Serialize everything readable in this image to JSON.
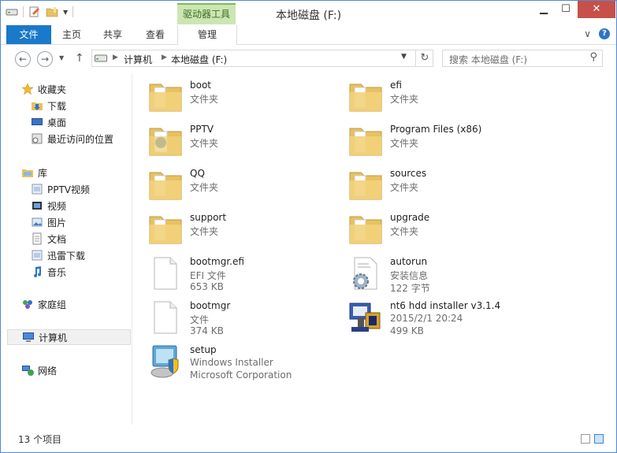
{
  "window": {
    "title": "本地磁盘 (F:)",
    "context_tab": "驱动器工具"
  },
  "ribbon": {
    "tabs": [
      "文件",
      "主页",
      "共享",
      "查看",
      "管理"
    ]
  },
  "address": {
    "crumbs": [
      "计算机",
      "本地磁盘 (F:)"
    ]
  },
  "search": {
    "placeholder": "搜索 本地磁盘 (F:)"
  },
  "nav": {
    "favorites": "收藏夹",
    "fav_items": [
      "下载",
      "桌面",
      "最近访问的位置"
    ],
    "libraries": "库",
    "lib_items": [
      "PPTV视频",
      "视频",
      "图片",
      "文档",
      "迅雷下载",
      "音乐"
    ],
    "homegroup": "家庭组",
    "computer": "计算机",
    "network": "网络"
  },
  "files": [
    {
      "name": "boot",
      "sub1": "文件夹",
      "icon": "folder-icon"
    },
    {
      "name": "efi",
      "sub1": "文件夹",
      "icon": "folder-icon"
    },
    {
      "name": "PPTV",
      "sub1": "文件夹",
      "icon": "pptv-folder-icon"
    },
    {
      "name": "Program Files (x86)",
      "sub1": "文件夹",
      "icon": "folder-icon"
    },
    {
      "name": "QQ",
      "sub1": "文件夹",
      "icon": "folder-icon"
    },
    {
      "name": "sources",
      "sub1": "文件夹",
      "icon": "folder-icon"
    },
    {
      "name": "support",
      "sub1": "文件夹",
      "icon": "folder-icon"
    },
    {
      "name": "upgrade",
      "sub1": "文件夹",
      "icon": "folder-icon"
    },
    {
      "name": "bootmgr.efi",
      "sub1": "EFI 文件",
      "sub2": "653 KB",
      "icon": "blank-file-icon"
    },
    {
      "name": "autorun",
      "sub1": "安装信息",
      "sub2": "122 字节",
      "icon": "setup-info-icon"
    },
    {
      "name": "bootmgr",
      "sub1": "文件",
      "sub2": "374 KB",
      "icon": "blank-file-icon"
    },
    {
      "name": "nt6 hdd installer v3.1.4",
      "sub1": "2015/2/1 20:24",
      "sub2": "499 KB",
      "icon": "installer-app-icon"
    },
    {
      "name": "setup",
      "sub1": "Windows Installer",
      "sub2": "Microsoft Corporation",
      "icon": "setup-app-icon"
    }
  ],
  "status": {
    "count": "13 个项目"
  },
  "colors": {
    "accent": "#1979ca",
    "context": "#cbe6b3",
    "close": "#c7504a",
    "folder": "#e8c160"
  }
}
